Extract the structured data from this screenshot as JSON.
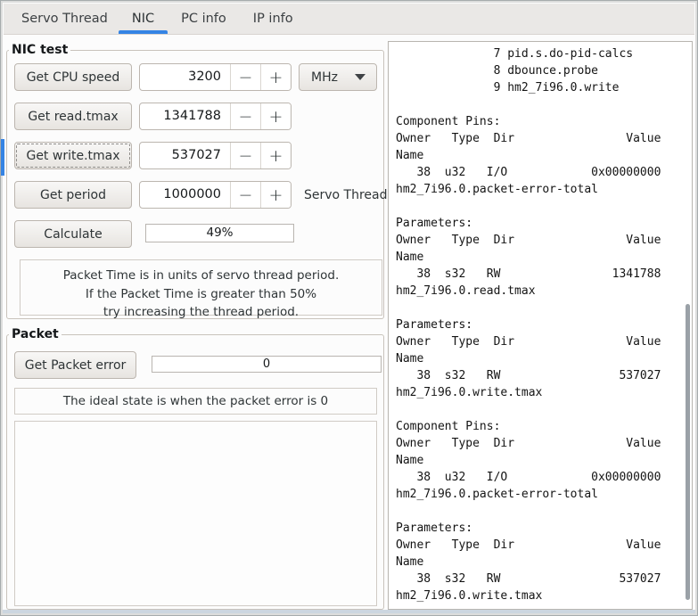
{
  "tabs": [
    {
      "label": "Servo Thread"
    },
    {
      "label": "NIC"
    },
    {
      "label": "PC info"
    },
    {
      "label": "IP info"
    }
  ],
  "icons": {
    "minus": "−",
    "plus": "+",
    "chevron_down": "▼"
  },
  "nic_test": {
    "title": "NIC test",
    "rows": [
      {
        "button": "Get CPU speed",
        "value": "3200",
        "unit": "MHz"
      },
      {
        "button": "Get read.tmax",
        "value": "1341788"
      },
      {
        "button": "Get write.tmax",
        "value": "537027"
      },
      {
        "button": "Get period",
        "value": "1000000",
        "suffix": "Servo Thread"
      }
    ],
    "calculate_button": "Calculate",
    "packet_time_percent": "49%",
    "note_line1": "Packet Time is in units of servo thread period.",
    "note_line2": "If the Packet Time is greater than 50%",
    "note_line3": "try increasing the thread period."
  },
  "packet": {
    "title": "Packet",
    "button": "Get Packet error",
    "error_value": "0",
    "note": "The ideal state is when the packet error is 0"
  },
  "output": {
    "lines": [
      "              7 pid.s.do-pid-calcs",
      "              8 dbounce.probe",
      "              9 hm2_7i96.0.write",
      "",
      "Component Pins:",
      "Owner   Type  Dir                Value",
      "Name",
      "   38  u32   I/O            0x00000000",
      "hm2_7i96.0.packet-error-total",
      "",
      "Parameters:",
      "Owner   Type  Dir                Value",
      "Name",
      "   38  s32   RW                1341788",
      "hm2_7i96.0.read.tmax",
      "",
      "Parameters:",
      "Owner   Type  Dir                Value",
      "Name",
      "   38  s32   RW                 537027",
      "hm2_7i96.0.write.tmax",
      "",
      "Component Pins:",
      "Owner   Type  Dir                Value",
      "Name",
      "   38  u32   I/O            0x00000000",
      "hm2_7i96.0.packet-error-total",
      "",
      "Parameters:",
      "Owner   Type  Dir                Value",
      "Name",
      "   38  s32   RW                 537027",
      "hm2_7i96.0.write.tmax"
    ]
  },
  "colors": {
    "accent": "#3584e4"
  }
}
